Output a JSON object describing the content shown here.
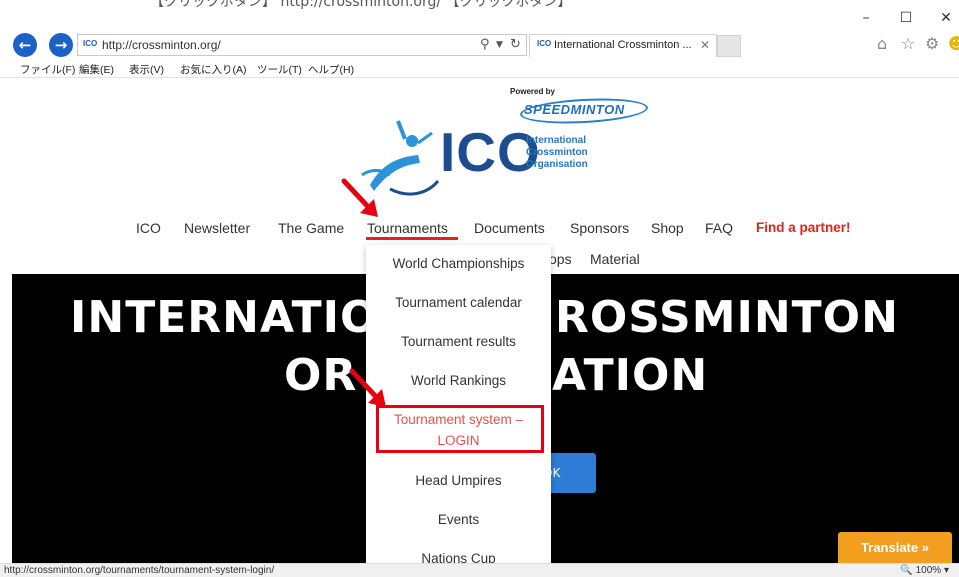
{
  "browser": {
    "caption_text": "【クリックボタン】  http://crossminton.org/  【クリックボタン】",
    "window_controls": [
      "–",
      "☐",
      "✕"
    ],
    "address": "http://crossminton.org/",
    "favicon_text": "ICO",
    "tab_title": "International Crossminton ...",
    "menu": [
      "ファイル(F)",
      "編集(E)",
      "表示(V)",
      "お気に入り(A)",
      "ツール(T)",
      "ヘルプ(H)"
    ],
    "status_url": "http://crossminton.org/tournaments/tournament-system-login/",
    "zoom": "100%"
  },
  "logo": {
    "powered_by": "Powered by",
    "sponsor": "SPEEDMINTON",
    "word": "ICO",
    "subtitle": [
      "International",
      "Crossminton",
      "Organisation"
    ]
  },
  "nav": {
    "items": [
      "ICO",
      "Newsletter",
      "The Game",
      "Tournaments",
      "Documents",
      "Sponsors",
      "Shop",
      "FAQ",
      "Find a partner!"
    ],
    "sub_items": [
      "ops",
      "Material"
    ]
  },
  "hero": {
    "line1_left": "INTERNATIO",
    "line1_right": "ROSSMINTON",
    "line2_left": "OR",
    "line2_right": "ATION",
    "button_label": "OK"
  },
  "dropdown": {
    "items": [
      "World Championships",
      "Tournament calendar",
      "Tournament results",
      "World Rankings",
      "Tournament system –",
      "LOGIN",
      "Head Umpires",
      "Events",
      "Nations Cup"
    ]
  },
  "translate_label": "Translate »",
  "colors": {
    "link_blue": "#1b62c6",
    "accent_red": "#e2231a",
    "highlight_box": "#e60012",
    "hero_bg": "#000000",
    "translate_orange": "#f29e1f"
  }
}
